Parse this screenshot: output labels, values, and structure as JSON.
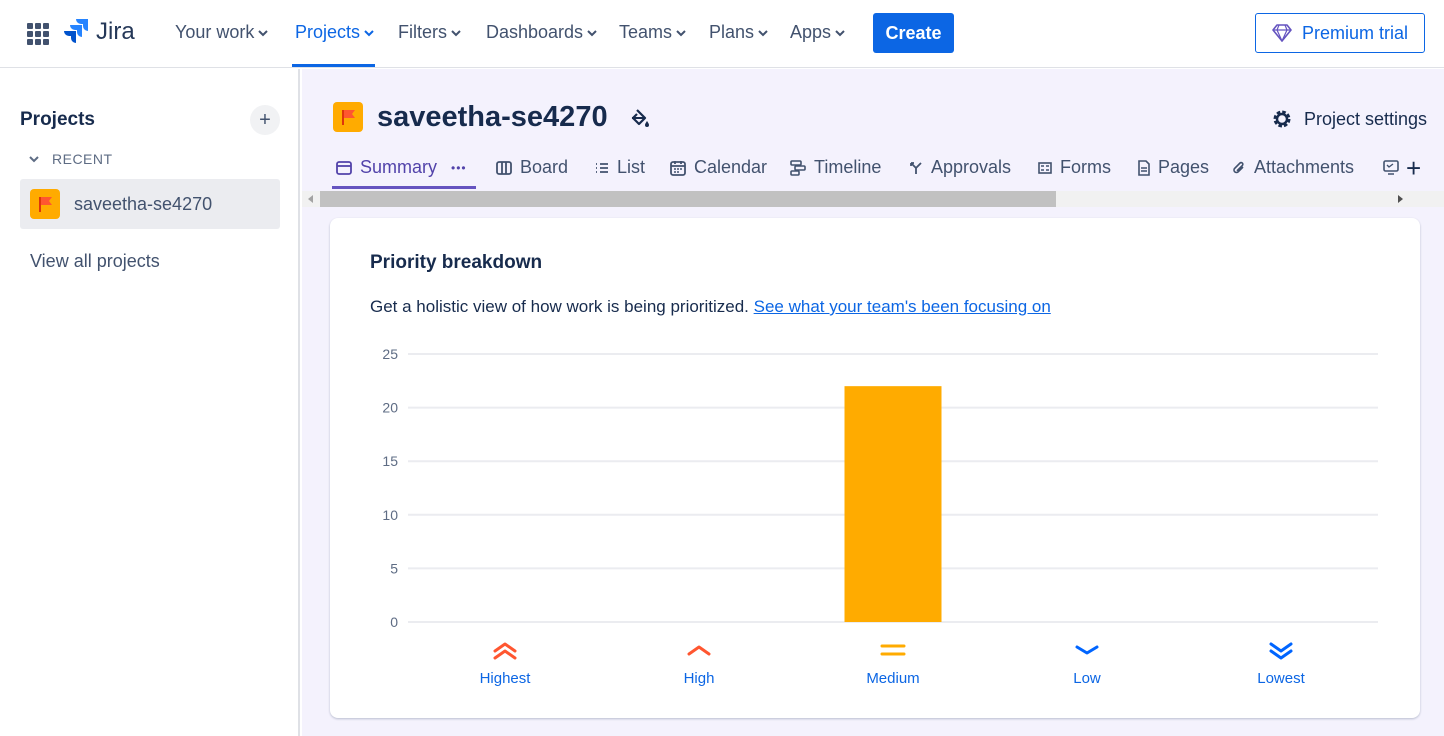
{
  "app": {
    "name": "Jira"
  },
  "nav": {
    "items": [
      {
        "label": "Your work"
      },
      {
        "label": "Projects",
        "active": true
      },
      {
        "label": "Filters"
      },
      {
        "label": "Dashboards"
      },
      {
        "label": "Teams"
      },
      {
        "label": "Plans"
      },
      {
        "label": "Apps"
      }
    ],
    "create": "Create",
    "premium": "Premium trial"
  },
  "sidebar": {
    "title": "Projects",
    "add": "+",
    "recent": "RECENT",
    "project": "saveetha-se4270",
    "view_all": "View all projects"
  },
  "project": {
    "name": "saveetha-se4270",
    "settings": "Project settings"
  },
  "tabs": [
    {
      "label": "Summary",
      "icon": "summary-icon",
      "active": true
    },
    {
      "label": "Board",
      "icon": "board-icon"
    },
    {
      "label": "List",
      "icon": "list-icon"
    },
    {
      "label": "Calendar",
      "icon": "calendar-icon"
    },
    {
      "label": "Timeline",
      "icon": "timeline-icon"
    },
    {
      "label": "Approvals",
      "icon": "approvals-icon"
    },
    {
      "label": "Forms",
      "icon": "forms-icon"
    },
    {
      "label": "Pages",
      "icon": "pages-icon"
    },
    {
      "label": "Attachments",
      "icon": "attachments-icon"
    }
  ],
  "tab_more": "•••",
  "tab_add": "+",
  "card": {
    "title": "Priority breakdown",
    "description": "Get a holistic view of how work is being prioritized.",
    "link": "See what your team's been focusing on"
  },
  "colors": {
    "primary": "#0c66e4",
    "bar": "#ffab00",
    "high": "#ff5630",
    "medium": "#ffab00",
    "low": "#0065ff"
  },
  "chart_data": {
    "type": "bar",
    "title": "Priority breakdown",
    "categories": [
      "Highest",
      "High",
      "Medium",
      "Low",
      "Lowest"
    ],
    "values": [
      0,
      0,
      22,
      0,
      0
    ],
    "ylim": [
      0,
      25
    ],
    "yticks": [
      0,
      5,
      10,
      15,
      20,
      25
    ],
    "grid": true,
    "category_icons": [
      "highest-priority-icon",
      "high-priority-icon",
      "medium-priority-icon",
      "low-priority-icon",
      "lowest-priority-icon"
    ]
  }
}
